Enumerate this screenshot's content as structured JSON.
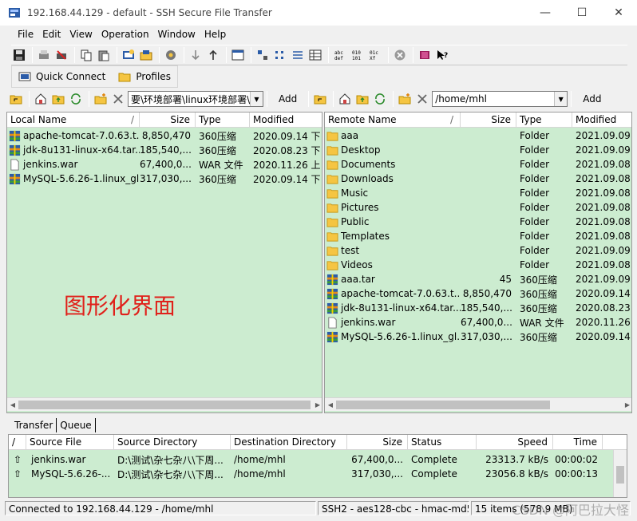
{
  "window": {
    "title": "192.168.44.129 - default - SSH Secure File Transfer",
    "minimize": "—",
    "maximize": "☐",
    "close": "✕"
  },
  "menu": [
    "File",
    "Edit",
    "View",
    "Operation",
    "Window",
    "Help"
  ],
  "toolbar2": {
    "quick_connect": "Quick Connect",
    "profiles": "Profiles"
  },
  "local": {
    "path": "要\\环境部署\\linux环境部署\\",
    "add": "Add",
    "columns": {
      "name": "Local Name",
      "size": "Size",
      "type": "Type",
      "modified": "Modified"
    },
    "files": [
      {
        "name": "apache-tomcat-7.0.63.t...",
        "size": "8,850,470",
        "type": "360压缩",
        "modified": "2020.09.14 下",
        "icon": "archive-icon"
      },
      {
        "name": "jdk-8u131-linux-x64.tar....",
        "size": "185,540,...",
        "type": "360压缩",
        "modified": "2020.08.23 下",
        "icon": "archive-icon"
      },
      {
        "name": "jenkins.war",
        "size": "67,400,0...",
        "type": "WAR 文件",
        "modified": "2020.11.26 上",
        "icon": "file-icon"
      },
      {
        "name": "MySQL-5.6.26-1.linux_gl...",
        "size": "317,030,...",
        "type": "360压缩",
        "modified": "2020.09.14 下",
        "icon": "archive-icon"
      }
    ],
    "overlay": "图形化界面"
  },
  "remote": {
    "path": "/home/mhl",
    "add": "Add",
    "columns": {
      "name": "Remote Name",
      "size": "Size",
      "type": "Type",
      "modified": "Modified"
    },
    "files": [
      {
        "name": "aaa",
        "size": "",
        "type": "Folder",
        "modified": "2021.09.09",
        "icon": "folder-icon"
      },
      {
        "name": "Desktop",
        "size": "",
        "type": "Folder",
        "modified": "2021.09.09",
        "icon": "folder-icon"
      },
      {
        "name": "Documents",
        "size": "",
        "type": "Folder",
        "modified": "2021.09.08",
        "icon": "folder-icon"
      },
      {
        "name": "Downloads",
        "size": "",
        "type": "Folder",
        "modified": "2021.09.08",
        "icon": "folder-icon"
      },
      {
        "name": "Music",
        "size": "",
        "type": "Folder",
        "modified": "2021.09.08",
        "icon": "folder-icon"
      },
      {
        "name": "Pictures",
        "size": "",
        "type": "Folder",
        "modified": "2021.09.08",
        "icon": "folder-icon"
      },
      {
        "name": "Public",
        "size": "",
        "type": "Folder",
        "modified": "2021.09.08",
        "icon": "folder-icon"
      },
      {
        "name": "Templates",
        "size": "",
        "type": "Folder",
        "modified": "2021.09.08",
        "icon": "folder-icon"
      },
      {
        "name": "test",
        "size": "",
        "type": "Folder",
        "modified": "2021.09.09",
        "icon": "folder-icon"
      },
      {
        "name": "Videos",
        "size": "",
        "type": "Folder",
        "modified": "2021.09.08",
        "icon": "folder-icon"
      },
      {
        "name": "aaa.tar",
        "size": "45",
        "type": "360压缩",
        "modified": "2021.09.09",
        "icon": "archive-icon"
      },
      {
        "name": "apache-tomcat-7.0.63.t...",
        "size": "8,850,470",
        "type": "360压缩",
        "modified": "2020.09.14",
        "icon": "archive-icon"
      },
      {
        "name": "jdk-8u131-linux-x64.tar....",
        "size": "185,540,...",
        "type": "360压缩",
        "modified": "2020.08.23",
        "icon": "archive-icon"
      },
      {
        "name": "jenkins.war",
        "size": "67,400,0...",
        "type": "WAR 文件",
        "modified": "2020.11.26",
        "icon": "file-icon"
      },
      {
        "name": "MySQL-5.6.26-1.linux_gl...",
        "size": "317,030,...",
        "type": "360压缩",
        "modified": "2020.09.14",
        "icon": "archive-icon"
      }
    ]
  },
  "transfer": {
    "tabs": [
      "Transfer",
      "Queue"
    ],
    "columns": {
      "dir": "/",
      "source_file": "Source File",
      "source_dir": "Source Directory",
      "dest_dir": "Destination Directory",
      "size": "Size",
      "status": "Status",
      "speed": "Speed",
      "time": "Time"
    },
    "rows": [
      {
        "arrow": "⇧",
        "file": "jenkins.war",
        "source_dir": "D:\\测试\\杂七杂八\\下周...",
        "dest_dir": "/home/mhl",
        "size": "67,400,0...",
        "status": "Complete",
        "speed": "23313.7 kB/s",
        "time": "00:00:02"
      },
      {
        "arrow": "⇧",
        "file": "MySQL-5.6.26-...",
        "source_dir": "D:\\测试\\杂七杂八\\下周...",
        "dest_dir": "/home/mhl",
        "size": "317,030,...",
        "status": "Complete",
        "speed": "23056.8 kB/s",
        "time": "00:00:13"
      }
    ]
  },
  "status": {
    "connection": "Connected to 192.168.44.129 - /home/mhl",
    "cipher": "SSH2 - aes128-cbc - hmac-md5",
    "items": "15 items (578.9 MB)"
  },
  "watermark": "CSDN @阿巴拉大怪",
  "colors": {
    "pane_bg": "#ccecd0",
    "overlay_text": "#e0201a",
    "folder": "#f5c542"
  }
}
